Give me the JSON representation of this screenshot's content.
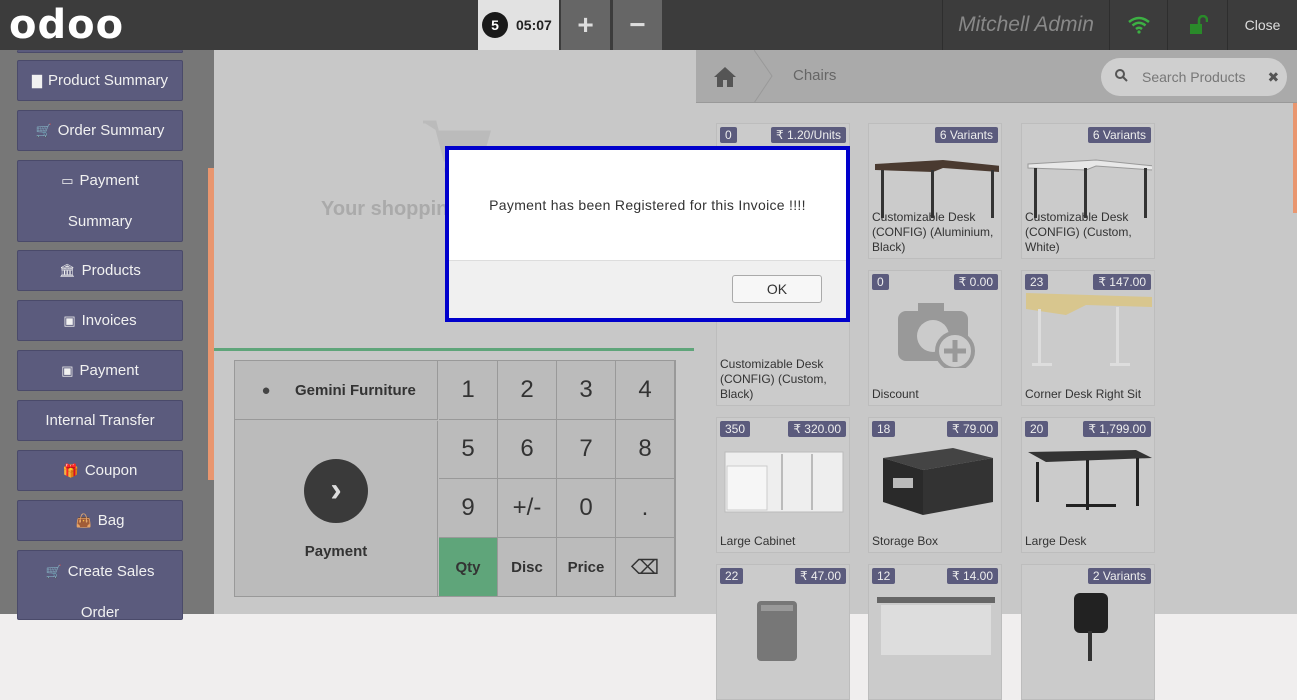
{
  "header": {
    "logo": "odoo",
    "order_number": "5",
    "order_time": "05:07",
    "add_label": "+",
    "remove_label": "−",
    "user": "Mitchell Admin",
    "close_label": "Close"
  },
  "sidebar": {
    "items": [
      {
        "label": "Product Summary",
        "icon": "document-icon"
      },
      {
        "label": "Order Summary",
        "icon": "cart-icon"
      },
      {
        "label": "Payment Summary",
        "icon": "credit-card-icon"
      },
      {
        "label": "Products",
        "icon": "bank-icon"
      },
      {
        "label": "Invoices",
        "icon": "money-icon"
      },
      {
        "label": "Payment",
        "icon": "money-icon"
      },
      {
        "label": "Internal Transfer",
        "icon": ""
      },
      {
        "label": "Coupon",
        "icon": "gift-icon"
      },
      {
        "label": "Bag",
        "icon": "bag-icon"
      },
      {
        "label": "Create Sales Order",
        "icon": "cart-icon"
      }
    ]
  },
  "cart": {
    "empty_text": "Your shoppin"
  },
  "pad": {
    "customer": "Gemini Furniture",
    "payment_label": "Payment",
    "keys": [
      "1",
      "2",
      "3",
      "4",
      "5",
      "6",
      "7",
      "8",
      "9",
      "+/-",
      "0",
      ".",
      "Qty",
      "Disc",
      "Price",
      "⌫"
    ]
  },
  "products": {
    "breadcrumb": "Chairs",
    "search_placeholder": "Search Products",
    "items": [
      {
        "qty": "0",
        "price": "₹ 1.20/Units",
        "name": ""
      },
      {
        "qty": "",
        "price": "6 Variants",
        "name": "Customizable Desk (CONFIG) (Aluminium, Black)"
      },
      {
        "qty": "",
        "price": "6 Variants",
        "name": "Customizable Desk (CONFIG) (Custom, White)"
      },
      {
        "qty": "",
        "price": "",
        "name": "Customizable Desk (CONFIG) (Custom, Black)"
      },
      {
        "qty": "0",
        "price": "₹ 0.00",
        "name": "Discount"
      },
      {
        "qty": "23",
        "price": "₹ 147.00",
        "name": "Corner Desk Right Sit"
      },
      {
        "qty": "350",
        "price": "₹ 320.00",
        "name": "Large Cabinet"
      },
      {
        "qty": "18",
        "price": "₹ 79.00",
        "name": "Storage Box"
      },
      {
        "qty": "20",
        "price": "₹ 1,799.00",
        "name": "Large Desk"
      },
      {
        "qty": "22",
        "price": "₹ 47.00",
        "name": ""
      },
      {
        "qty": "12",
        "price": "₹ 14.00",
        "name": ""
      },
      {
        "qty": "",
        "price": "2 Variants",
        "name": ""
      }
    ]
  },
  "dialog": {
    "message": "Payment has been Registered for this Invoice !!!!",
    "ok_label": "OK"
  }
}
